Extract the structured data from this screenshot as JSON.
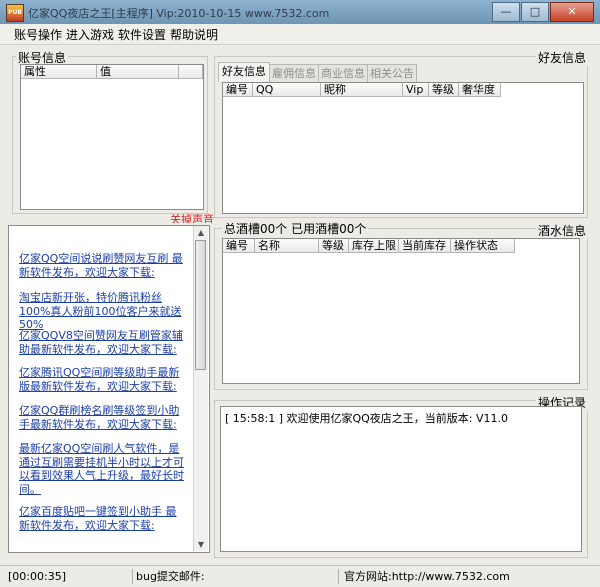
{
  "window": {
    "title": "亿家QQ夜店之王[主程序] Vip:2010-10-15 www.7532.com",
    "icon_text": "PUB",
    "buttons": {
      "minimize": "—",
      "maximize": "□",
      "close": "✕"
    }
  },
  "menu": [
    "账号操作",
    "进入游戏",
    "软件设置",
    "帮助说明"
  ],
  "account_panel": {
    "label": "账号信息",
    "columns": [
      "属性",
      "值"
    ]
  },
  "tip_text": "关掉声音",
  "friend_panel": {
    "label": "好友信息",
    "tabs": [
      "好友信息",
      "雇佣信息",
      "商业信息",
      "相关公告"
    ],
    "columns": [
      "编号",
      "QQ",
      "昵称",
      "Vip",
      "等级",
      "奢华度"
    ]
  },
  "drinks_panel": {
    "label": "酒水信息",
    "summary": "总酒槽00个 已用酒槽00个",
    "columns": [
      "编号",
      "名称",
      "等级",
      "库存上限",
      "当前库存",
      "操作状态"
    ]
  },
  "news": [
    "亿家QQ空间说说刷赞网友互刷 最新软件发布，欢迎大家下载:",
    "淘宝店新开张，特价腾讯粉丝100%真人粉前100位客户来就送50%",
    "亿家QQV8空间赞网友互刷管家辅助最新软件发布，欢迎大家下载:",
    "亿家腾讯QQ空间刷等级助手最新版最新软件发布，欢迎大家下载:",
    "亿家QQ群刷榜名刷等级签到小助手最新软件发布，欢迎大家下载:",
    "最新亿家QQ空间刷人气软件，是通过互刷需要挂机半小时以上才可以看到效果人气上升级，最好长时间。",
    "亿家百度贴吧一键签到小助手 最新软件发布，欢迎大家下载:"
  ],
  "log_panel": {
    "label": "操作记录",
    "lines": [
      "[ 15:58:1 ] 欢迎使用亿家QQ夜店之王，当前版本: V11.0"
    ]
  },
  "statusbar": {
    "timer": "[00:00:35]",
    "bug_label": "bug提交邮件:",
    "site": "官方网站:http://www.7532.com"
  }
}
